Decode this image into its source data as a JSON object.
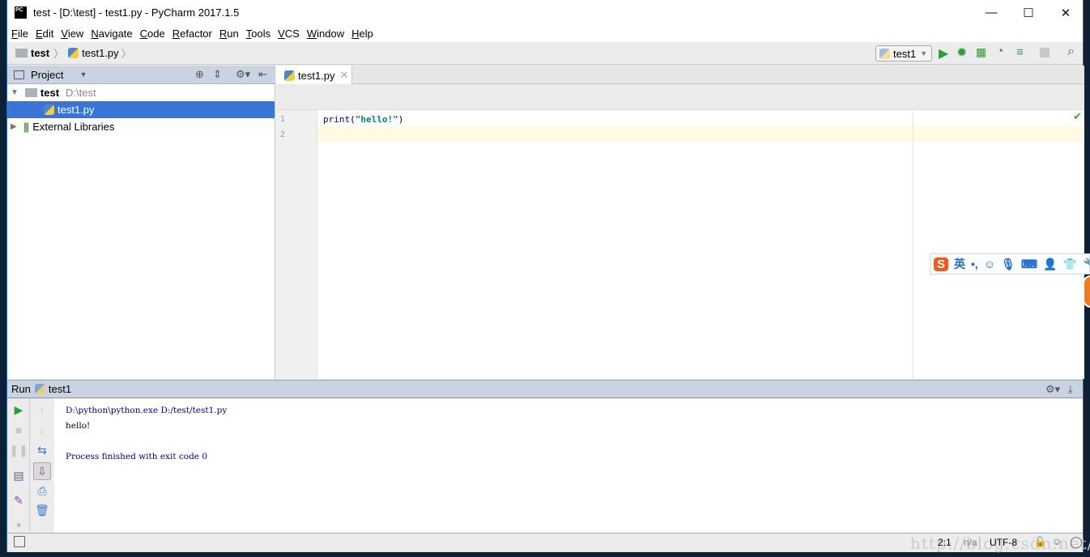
{
  "window": {
    "title": "test - [D:\\test] - test1.py - PyCharm 2017.1.5",
    "logo": "PC",
    "minimize": "—",
    "maximize": "☐",
    "close": "✕"
  },
  "menu": [
    "File",
    "Edit",
    "View",
    "Navigate",
    "Code",
    "Refactor",
    "Run",
    "Tools",
    "VCS",
    "Window",
    "Help"
  ],
  "breadcrumb": {
    "project": "test",
    "file": "test1.py"
  },
  "run_config": {
    "name": "test1"
  },
  "project_panel": {
    "title": "Project",
    "tree": [
      {
        "label": "test",
        "path": "D:\\test"
      },
      {
        "label": "test1.py"
      },
      {
        "label": "External Libraries"
      }
    ]
  },
  "editor": {
    "tab": "test1.py",
    "lines": [
      "1",
      "2"
    ],
    "code": {
      "fn": "print",
      "open": "(",
      "str": "\"hello!\"",
      "close": ")"
    }
  },
  "run_panel": {
    "title": "Run",
    "config": "test1",
    "output": [
      "D:\\python\\python.exe D:/test/test1.py",
      "hello!",
      "",
      "Process finished with exit code 0"
    ]
  },
  "status_bar": {
    "position": "2:1",
    "line_sep": "n/a",
    "encoding": "UTF-8",
    "watermark": "http://blog.csdn.net/"
  },
  "ime": {
    "lang": "英",
    "punct": "•,"
  }
}
